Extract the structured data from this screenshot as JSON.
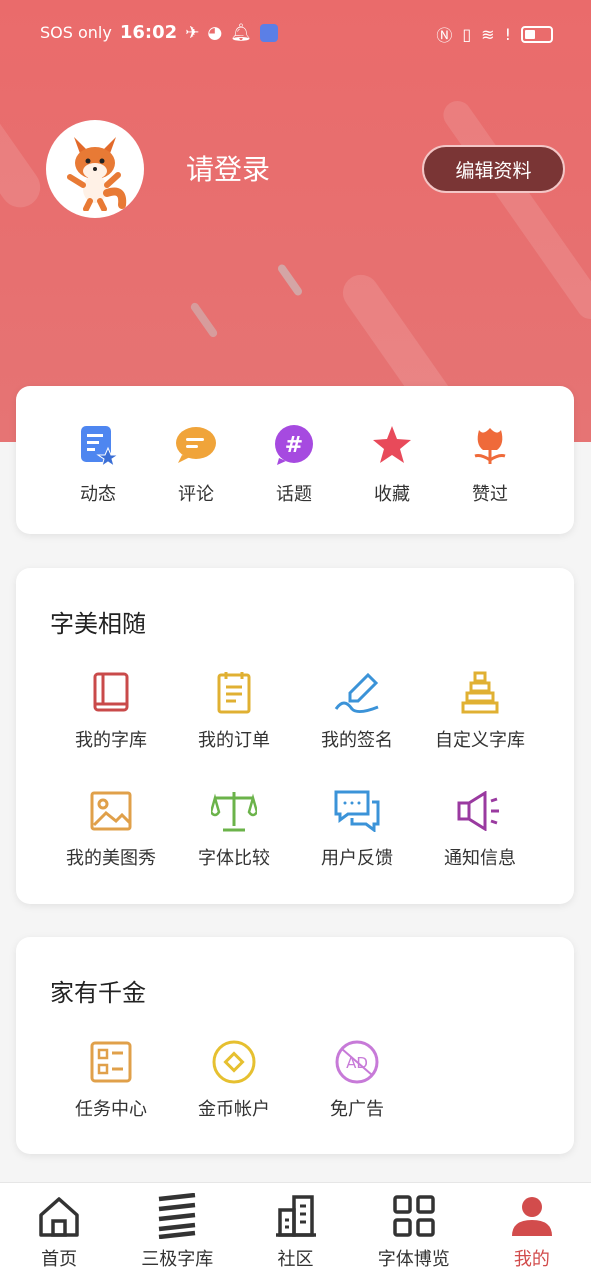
{
  "status_bar": {
    "sos": "SOS only",
    "time": "16:02"
  },
  "profile": {
    "login_text": "请登录",
    "edit_button": "编辑资料"
  },
  "quick_actions": [
    {
      "label": "动态",
      "icon": "dynamic-icon"
    },
    {
      "label": "评论",
      "icon": "comment-icon"
    },
    {
      "label": "话题",
      "icon": "hashtag-icon"
    },
    {
      "label": "收藏",
      "icon": "star-icon"
    },
    {
      "label": "赞过",
      "icon": "flower-icon"
    }
  ],
  "section1": {
    "title": "字美相随",
    "items": [
      {
        "label": "我的字库",
        "icon": "book-icon"
      },
      {
        "label": "我的订单",
        "icon": "order-icon"
      },
      {
        "label": "我的签名",
        "icon": "signature-icon"
      },
      {
        "label": "自定义字库",
        "icon": "stack-icon"
      },
      {
        "label": "我的美图秀",
        "icon": "image-icon"
      },
      {
        "label": "字体比较",
        "icon": "scale-icon"
      },
      {
        "label": "用户反馈",
        "icon": "feedback-icon"
      },
      {
        "label": "通知信息",
        "icon": "megaphone-icon"
      }
    ]
  },
  "section2": {
    "title": "家有千金",
    "items": [
      {
        "label": "任务中心",
        "icon": "task-icon"
      },
      {
        "label": "金币帐户",
        "icon": "coin-icon"
      },
      {
        "label": "免广告",
        "icon": "no-ad-icon"
      }
    ]
  },
  "tabbar": [
    {
      "label": "首页",
      "icon": "home-icon"
    },
    {
      "label": "三极字库",
      "icon": "layers-icon"
    },
    {
      "label": "社区",
      "icon": "building-icon"
    },
    {
      "label": "字体博览",
      "icon": "grid-icon"
    },
    {
      "label": "我的",
      "icon": "user-icon",
      "active": true
    }
  ],
  "colors": {
    "header": "#e96f6f",
    "edit_button_bg": "#7a3535",
    "active_tab": "#d24c4c"
  }
}
